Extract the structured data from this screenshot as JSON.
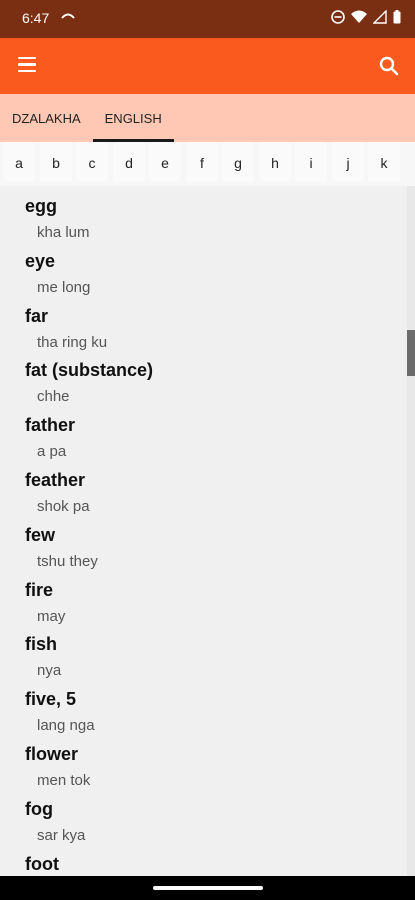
{
  "status": {
    "time": "6:47"
  },
  "tabs": [
    {
      "label": "DZALAKHA",
      "active": false
    },
    {
      "label": "ENGLISH",
      "active": true
    }
  ],
  "letters": [
    "a",
    "b",
    "c",
    "d",
    "e",
    "f",
    "g",
    "h",
    "i",
    "j",
    "k"
  ],
  "entries": [
    {
      "word": "egg",
      "translation": "kha lum"
    },
    {
      "word": "eye",
      "translation": "me long"
    },
    {
      "word": "far",
      "translation": "tha ring ku"
    },
    {
      "word": "fat (substance)",
      "translation": "chhe"
    },
    {
      "word": "father",
      "translation": "a pa"
    },
    {
      "word": "feather",
      "translation": "shok pa"
    },
    {
      "word": "few",
      "translation": "tshu they"
    },
    {
      "word": "fire",
      "translation": "may"
    },
    {
      "word": "fish",
      "translation": "nya"
    },
    {
      "word": "five, 5",
      "translation": "lang nga"
    },
    {
      "word": "flower",
      "translation": "men tok"
    },
    {
      "word": "fog",
      "translation": "sar kya"
    },
    {
      "word": "foot",
      "translation": ""
    }
  ],
  "colors": {
    "status_bar": "#7a2e12",
    "app_bar": "#fa5a1e",
    "tabs_bg": "#ffc8b4"
  },
  "icons": {
    "menu": "menu-icon",
    "search": "search-icon"
  }
}
